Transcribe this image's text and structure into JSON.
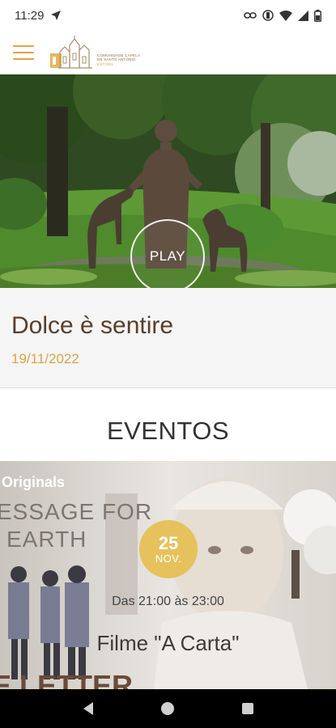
{
  "status_bar": {
    "time": "11:29",
    "icons": [
      "navigation-icon",
      "link-icon",
      "vibrate-icon",
      "wifi-icon",
      "signal-icon",
      "battery-icon"
    ]
  },
  "header": {
    "menu_icon": "hamburger-menu-icon",
    "logo_line1": "COMUNIDADE CAPELA",
    "logo_line2": "DE SANTO ANTÓNIO",
    "logo_line3": "ESTORIL",
    "accent_color": "#d9a44a"
  },
  "hero": {
    "play_label": "PLAY"
  },
  "featured": {
    "title": "Dolce è sentire",
    "date": "19/11/2022",
    "title_color": "#5a3e2a",
    "date_color": "#d9a44a"
  },
  "events_section": {
    "title": "EVENTOS"
  },
  "event": {
    "poster_text_top": "Originals",
    "poster_text_line1": "ESSAGE FOR",
    "poster_text_line2": "EARTH",
    "poster_text_bottom": "E LETTER",
    "day": "25",
    "month": "NOV.",
    "time": "Das 21:00 às 23:00",
    "title": "Filme \"A Carta\"",
    "badge_color": "#e5c25b"
  },
  "nav_bar": {
    "back_icon": "back-triangle-icon",
    "home_icon": "home-circle-icon",
    "recents_icon": "recents-square-icon"
  }
}
